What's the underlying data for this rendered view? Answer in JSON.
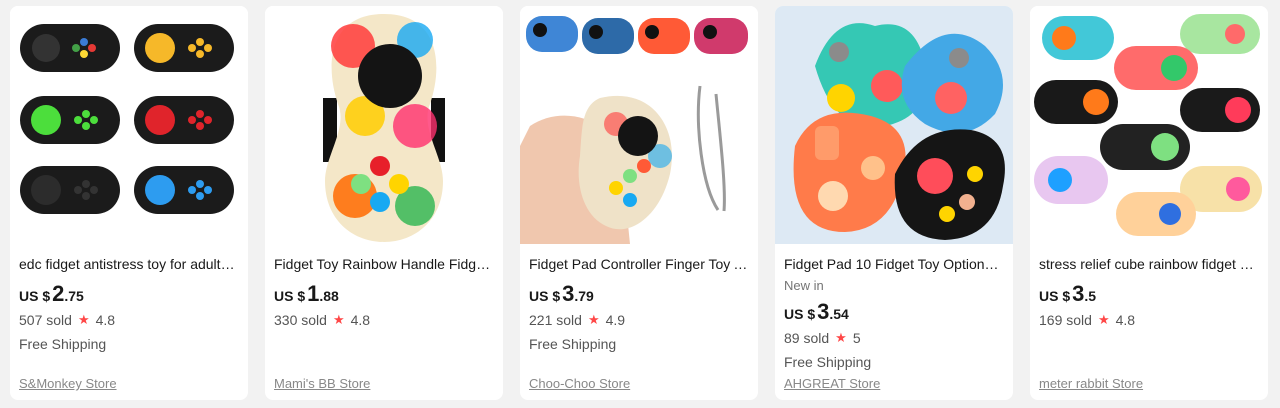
{
  "products": [
    {
      "title": "edc fidget antistress toy for adults ...",
      "currency": "US $",
      "price_int": "2",
      "price_dec": ".75",
      "sold": "507 sold",
      "rating": "4.8",
      "shipping": "Free Shipping",
      "store": "S&Monkey Store",
      "image": "black-controller-fidget-pads-collage"
    },
    {
      "title": "Fidget Toy Rainbow Handle Fidget ...",
      "currency": "US $",
      "price_int": "1",
      "price_dec": ".88",
      "sold": "330 sold",
      "rating": "4.8",
      "store": "Mami's BB Store",
      "image": "rainbow-splatter-fidget-pad"
    },
    {
      "title": "Fidget Pad Controller Finger Toy A...",
      "currency": "US $",
      "price_int": "3",
      "price_dec": ".79",
      "sold": "221 sold",
      "rating": "4.9",
      "shipping": "Free Shipping",
      "store": "Choo-Choo Store",
      "image": "hand-holding-fidget-pad-with-lanyard"
    },
    {
      "title": "Fidget Pad 10 Fidget Toy Options i...",
      "new_in": "New in",
      "currency": "US $",
      "price_int": "3",
      "price_dec": ".54",
      "sold": "89 sold",
      "rating": "5",
      "shipping": "Free Shipping",
      "store": "AHGREAT Store",
      "image": "triangle-fidget-spinner-pads"
    },
    {
      "title": "stress relief cube rainbow fidget g...",
      "currency": "US $",
      "price_int": "3",
      "price_dec": ".5",
      "sold": "169 sold",
      "rating": "4.8",
      "store": "meter rabbit Store",
      "image": "colorful-fidget-pads-pile"
    }
  ],
  "colors": {
    "star": "#ff4747",
    "background": "#f2f2f2"
  }
}
